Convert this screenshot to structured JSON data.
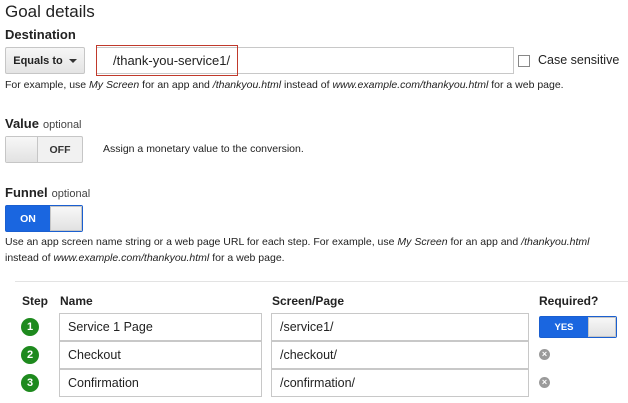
{
  "title": "Goal details",
  "destination": {
    "label": "Destination",
    "match_type": "Equals to",
    "value": "/thank-you-service1/",
    "case_sensitive_label": "Case sensitive",
    "help_prefix": "For example, use ",
    "help_app": "My Screen",
    "help_mid1": " for an app and ",
    "help_path": "/thankyou.html",
    "help_mid2": " instead of ",
    "help_url": "www.example.com/thankyou.html",
    "help_suffix": " for a web page."
  },
  "value_section": {
    "label": "Value",
    "optional": "optional",
    "toggle_text": "OFF",
    "description": "Assign a monetary value to the conversion."
  },
  "funnel": {
    "label": "Funnel",
    "optional": "optional",
    "toggle_text": "ON",
    "help_line1_prefix": "Use an app screen name string or a web page URL for each step. For example, use ",
    "help_app": "My Screen",
    "help_mid1": " for an app and ",
    "help_path": "/thankyou.html",
    "help_line2_prefix": "instead of ",
    "help_url": "www.example.com/thankyou.html",
    "help_suffix": " for a web page."
  },
  "steps_table": {
    "headers": {
      "step": "Step",
      "name": "Name",
      "screen": "Screen/Page",
      "required": "Required?"
    },
    "rows": [
      {
        "step": "1",
        "name": "Service 1 Page",
        "screen": "/service1/"
      },
      {
        "step": "2",
        "name": "Checkout",
        "screen": "/checkout/"
      },
      {
        "step": "3",
        "name": "Confirmation",
        "screen": "/confirmation/"
      }
    ],
    "required_toggle_text": "YES",
    "remove_glyph": "×"
  },
  "colors": {
    "toggle_on": "#1a66e0",
    "step_circle": "#1e8a1e",
    "highlight_border": "#c0392b"
  }
}
